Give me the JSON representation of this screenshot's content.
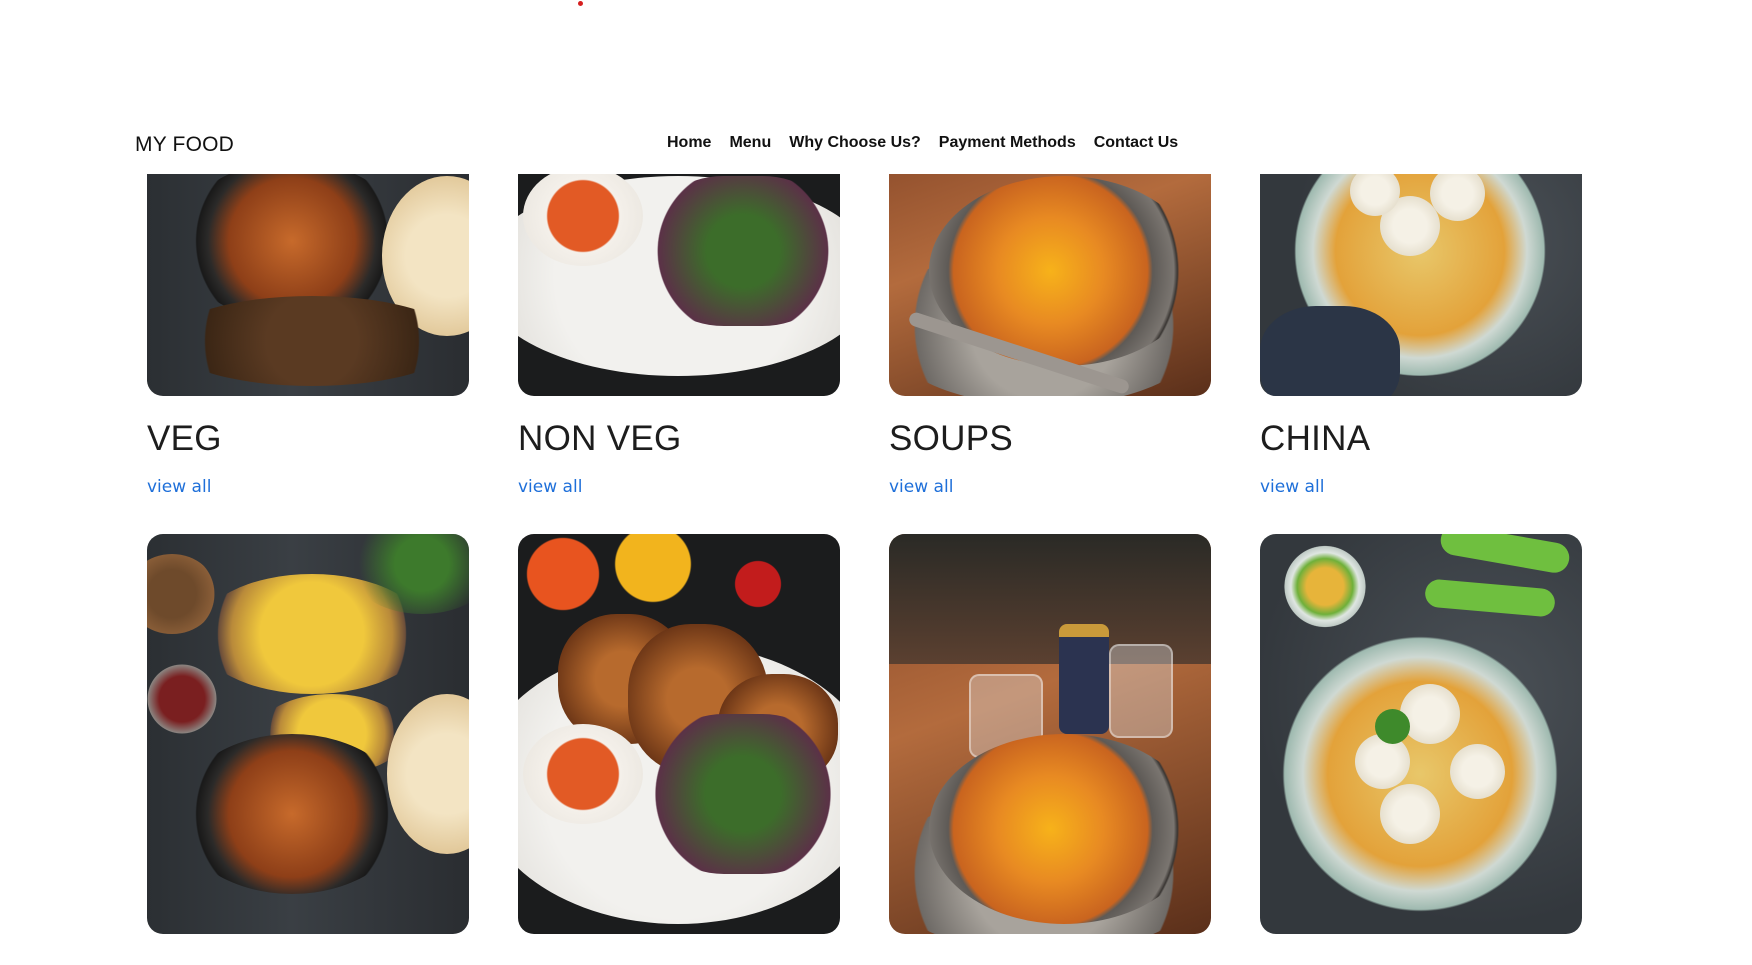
{
  "brand": "MY FOOD",
  "nav": {
    "items": [
      {
        "label": "Home"
      },
      {
        "label": "Menu"
      },
      {
        "label": "Why Choose Us?"
      },
      {
        "label": "Payment Methods"
      },
      {
        "label": "Contact Us"
      }
    ]
  },
  "categories": [
    {
      "title": "VEG",
      "link": "view all",
      "image": "veg-curry-photo"
    },
    {
      "title": "NON VEG",
      "link": "view all",
      "image": "grilled-chicken-photo"
    },
    {
      "title": "SOUPS",
      "link": "view all",
      "image": "pumpkin-soup-photo"
    },
    {
      "title": "CHINA",
      "link": "view all",
      "image": "momo-soup-photo"
    }
  ],
  "second_row": [
    {
      "image": "veg-curry-photo"
    },
    {
      "image": "grilled-chicken-photo"
    },
    {
      "image": "pumpkin-soup-photo"
    },
    {
      "image": "momo-soup-photo"
    }
  ]
}
